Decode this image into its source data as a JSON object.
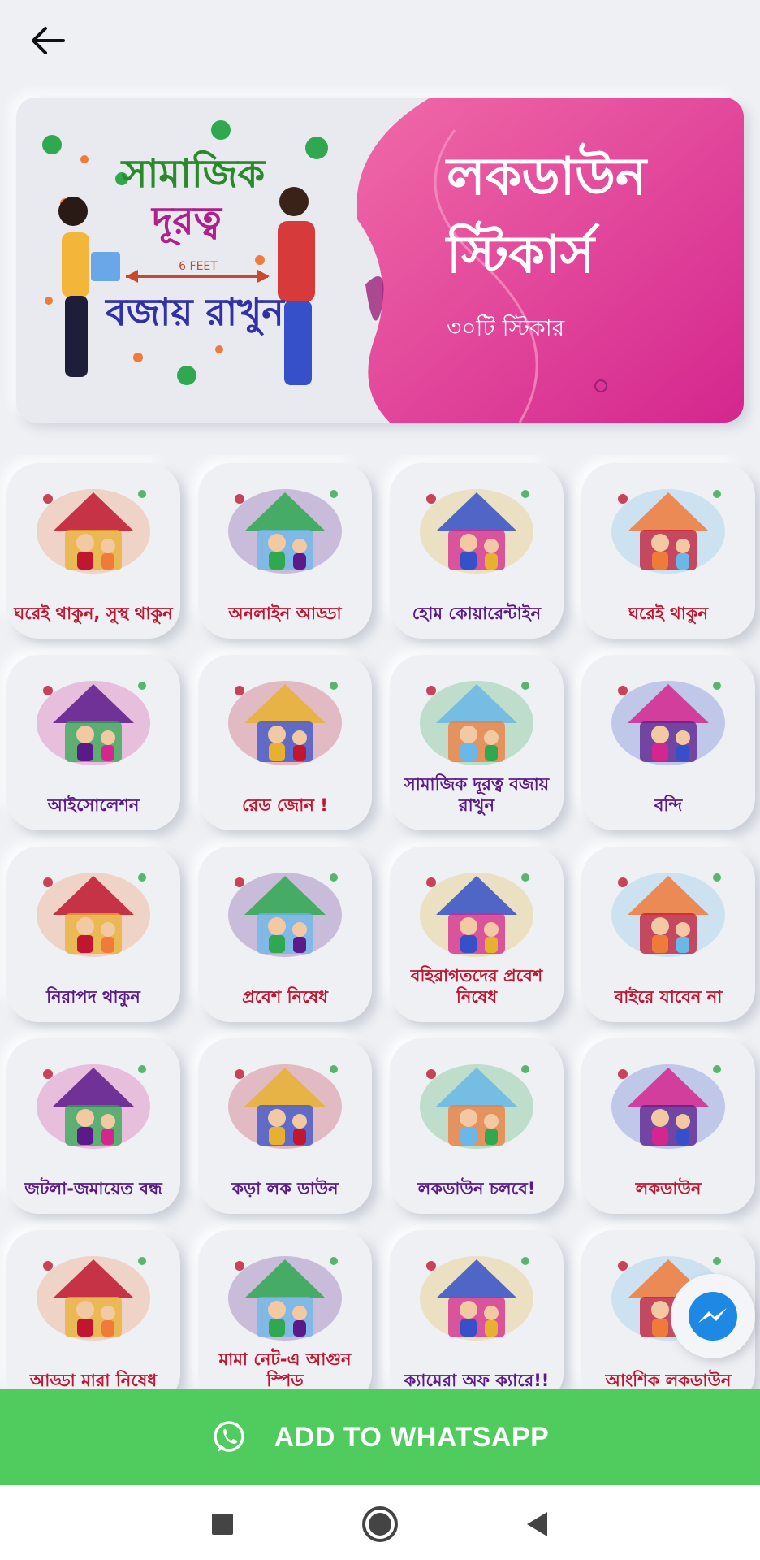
{
  "banner": {
    "title_line1": "লকডাউন",
    "title_line2": "স্টিকার্স",
    "sticker_count": "৩০টি স্টিকার",
    "art_line1": "সামাজিক",
    "art_line2": "দূরত্ব",
    "art_distance": "6 FEET",
    "art_line3": "বজায় রাখুন"
  },
  "stickers": [
    {
      "caption": "ঘরেই থাকুন, সুস্থ থাকুন",
      "icon": "house-family-icon",
      "color": "#c0162f"
    },
    {
      "caption": "অনলাইন আড্ডা",
      "icon": "video-call-icon",
      "color": "#c0162f"
    },
    {
      "caption": "হোম কোয়ারেন্টাইন",
      "icon": "home-quarantine-icon",
      "color": "#5a1a8a"
    },
    {
      "caption": "ঘরেই থাকুন",
      "icon": "green-house-icon",
      "color": "#c0162f"
    },
    {
      "caption": "আইসোলেশন",
      "icon": "hospital-bed-icon",
      "color": "#5a1a8a"
    },
    {
      "caption": "রেড জোন !",
      "icon": "warning-siren-icon",
      "color": "#c0162f"
    },
    {
      "caption": "সামাজিক দূরত্ব বজায় রাখুন",
      "icon": "social-distance-icon",
      "color": "#5a1a8a"
    },
    {
      "caption": "বন্দি",
      "icon": "orange-house-icon",
      "color": "#5a1a8a"
    },
    {
      "caption": "নিরাপদ থাকুন",
      "icon": "doctor-globe-icon",
      "color": "#5a1a8a"
    },
    {
      "caption": "প্রবেশ নিষেধ",
      "icon": "police-stop-icon",
      "color": "#c0162f"
    },
    {
      "caption": "বহিরাগতদের প্রবেশ নিষেধ",
      "icon": "lockdown-scene-icon",
      "color": "#c0162f"
    },
    {
      "caption": "বাইরে যাবেন না",
      "icon": "police-closed-icon",
      "color": "#c0162f"
    },
    {
      "caption": "জটলা-জমায়েত বন্ধ",
      "icon": "crowd-banned-icon",
      "color": "#5a1a8a"
    },
    {
      "caption": "কড়া লক ডাউন",
      "icon": "strict-lockdown-icon",
      "color": "#5a1a8a"
    },
    {
      "caption": "লকডাউন চলবে!",
      "icon": "chains-warning-icon",
      "color": "#5a1a8a"
    },
    {
      "caption": "লকডাউন",
      "icon": "city-lockdown-icon",
      "color": "#c0162f"
    },
    {
      "caption": "আড্ডা মারা নিষেধ",
      "icon": "group-chat-icon",
      "color": "#c0162f"
    },
    {
      "caption": "মামা নেট-এ আগুন স্পিড",
      "icon": "fast-internet-icon",
      "color": "#c0162f"
    },
    {
      "caption": "ক্যামেরা অফ ক্যারে!!",
      "icon": "camera-off-icon",
      "color": "#5a1a8a"
    },
    {
      "caption": "আংশিক লকডাউন",
      "icon": "partial-lockdown-icon",
      "color": "#c0162f"
    }
  ],
  "cta": {
    "label": "ADD TO WHATSAPP"
  },
  "colors": {
    "pink": "#ec4899",
    "green": "#4fcc5d",
    "messenger": "#1e88e5"
  }
}
